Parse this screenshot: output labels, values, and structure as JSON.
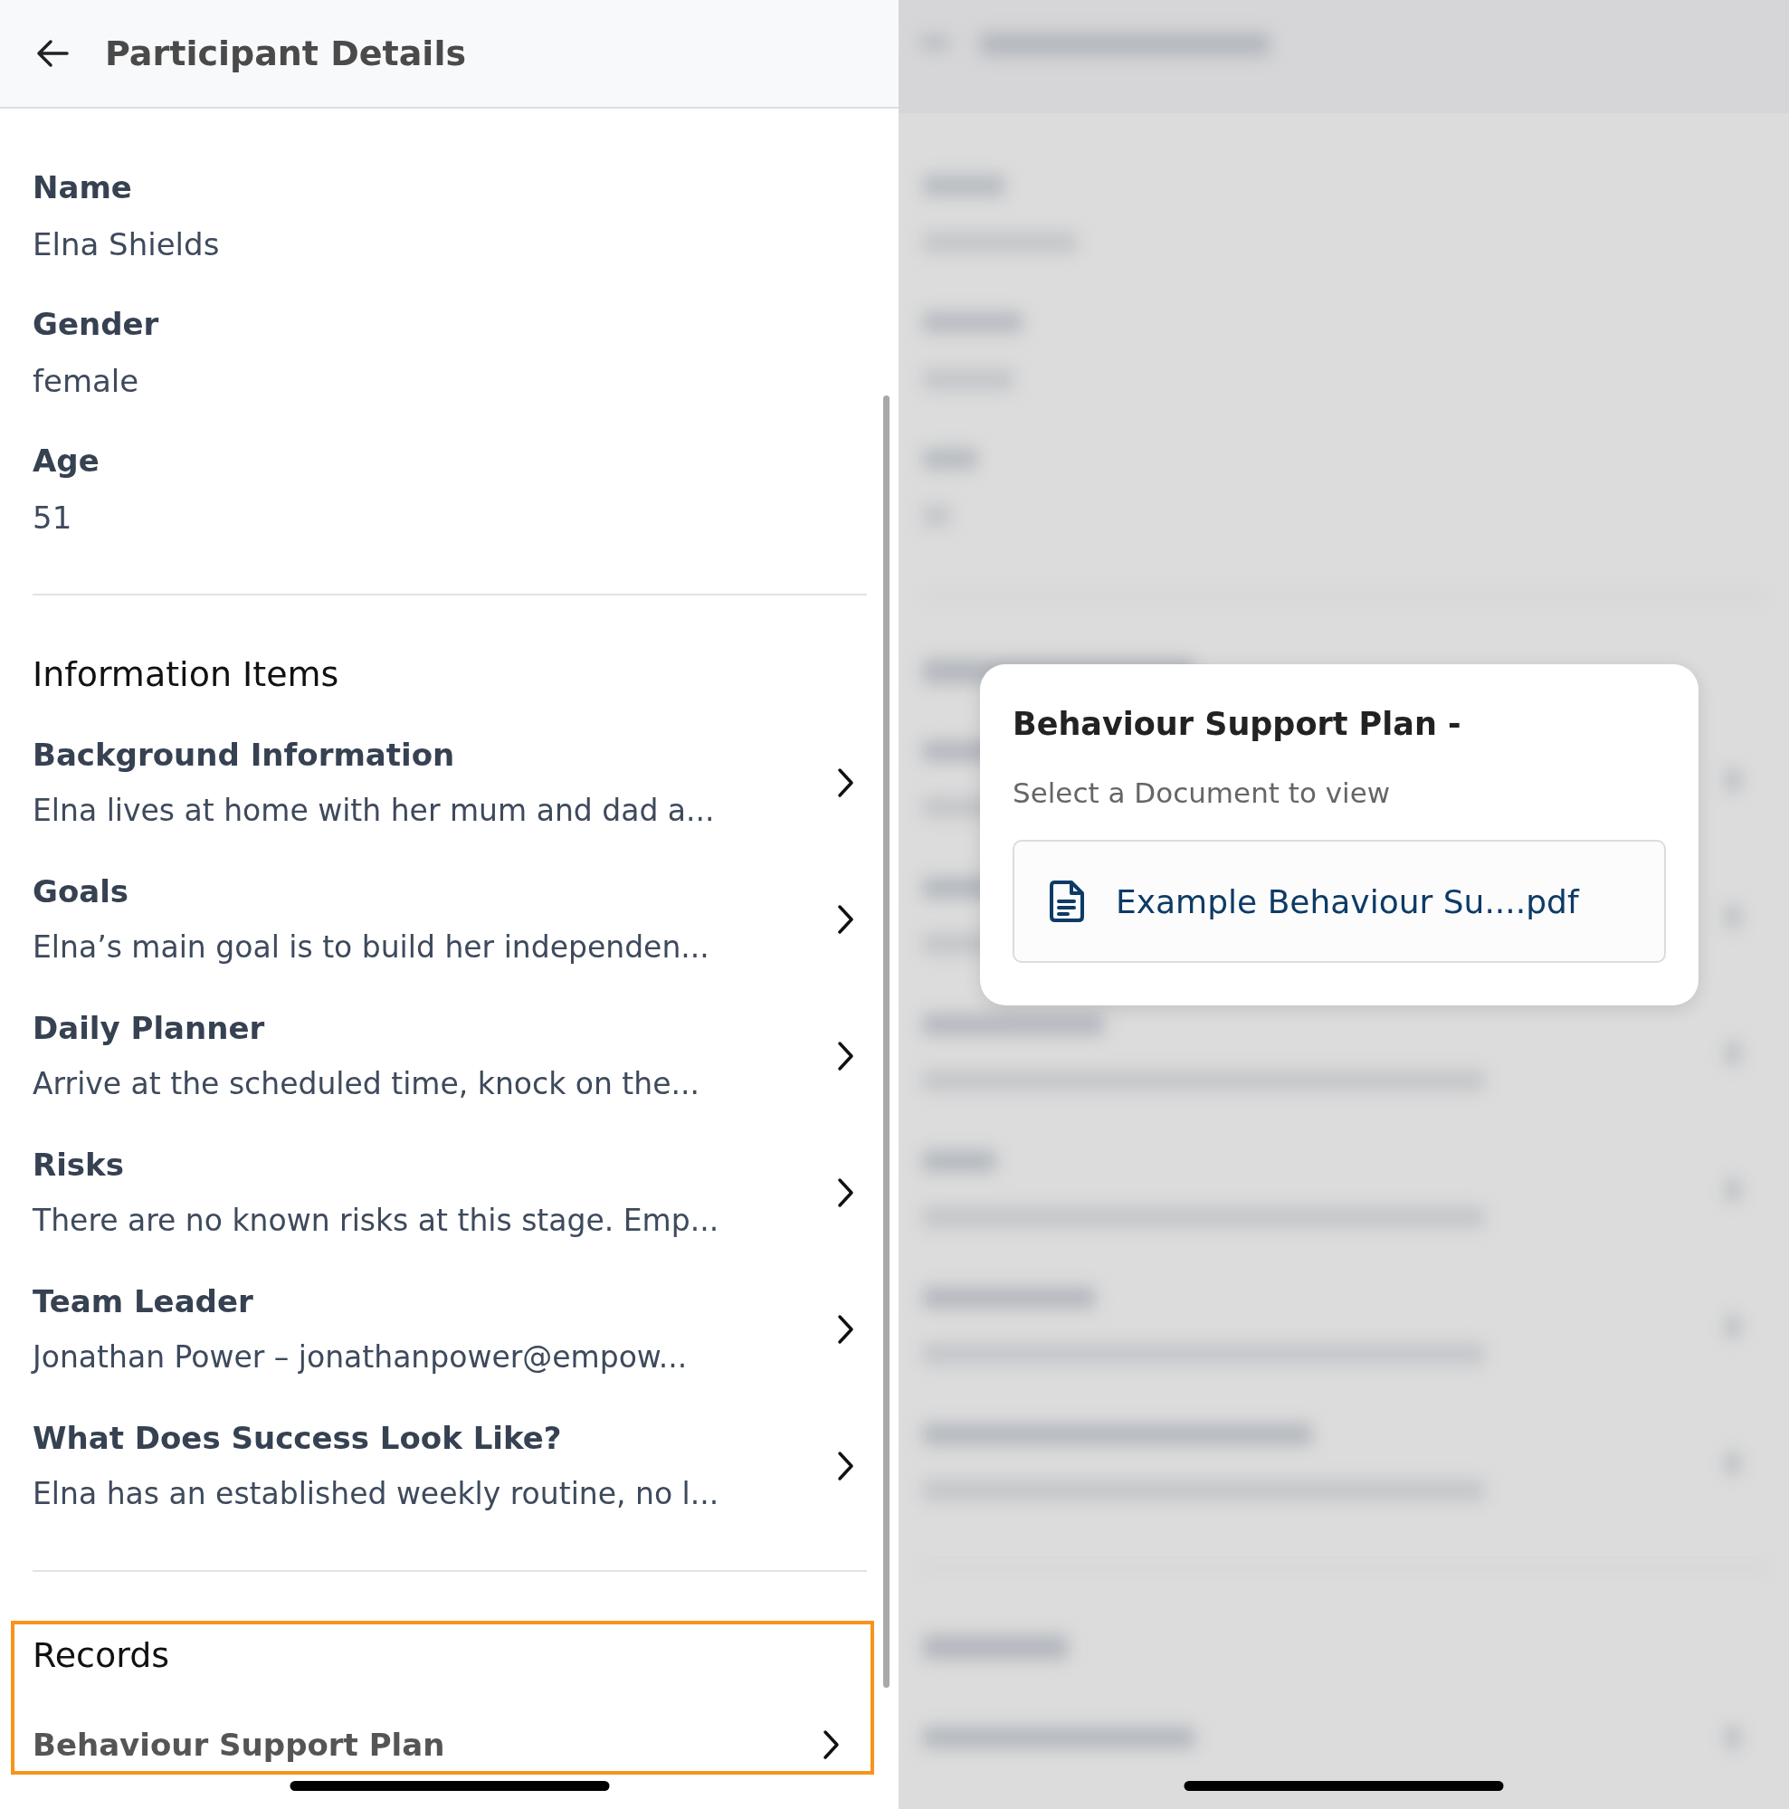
{
  "header": {
    "title": "Participant Details"
  },
  "fields": [
    {
      "label": "Name",
      "value": "Elna Shields"
    },
    {
      "label": "Gender",
      "value": "female"
    },
    {
      "label": "Age",
      "value": "51"
    }
  ],
  "information_items": {
    "title": "Information Items",
    "items": [
      {
        "title": "Background Information",
        "summary": "Elna lives at home with her mum and dad a..."
      },
      {
        "title": "Goals",
        "summary": "Elna’s main goal is to build her independen..."
      },
      {
        "title": "Daily Planner",
        "summary": "Arrive at the scheduled time, knock on the..."
      },
      {
        "title": "Risks",
        "summary": "There are no known risks at this stage. Emp..."
      },
      {
        "title": "Team Leader",
        "summary": "Jonathan Power – jonathanpower@empow..."
      },
      {
        "title": "What Does Success Look Like?",
        "summary": "Elna has an established weekly routine, no l..."
      }
    ]
  },
  "records": {
    "title": "Records",
    "highlighted": true,
    "items": [
      {
        "title": "Behaviour Support Plan"
      }
    ]
  },
  "dialog": {
    "title": "Behaviour Support Plan -",
    "subtitle": "Select a Document to view",
    "documents": [
      {
        "name": "Example Behaviour Su....pdf"
      }
    ]
  }
}
